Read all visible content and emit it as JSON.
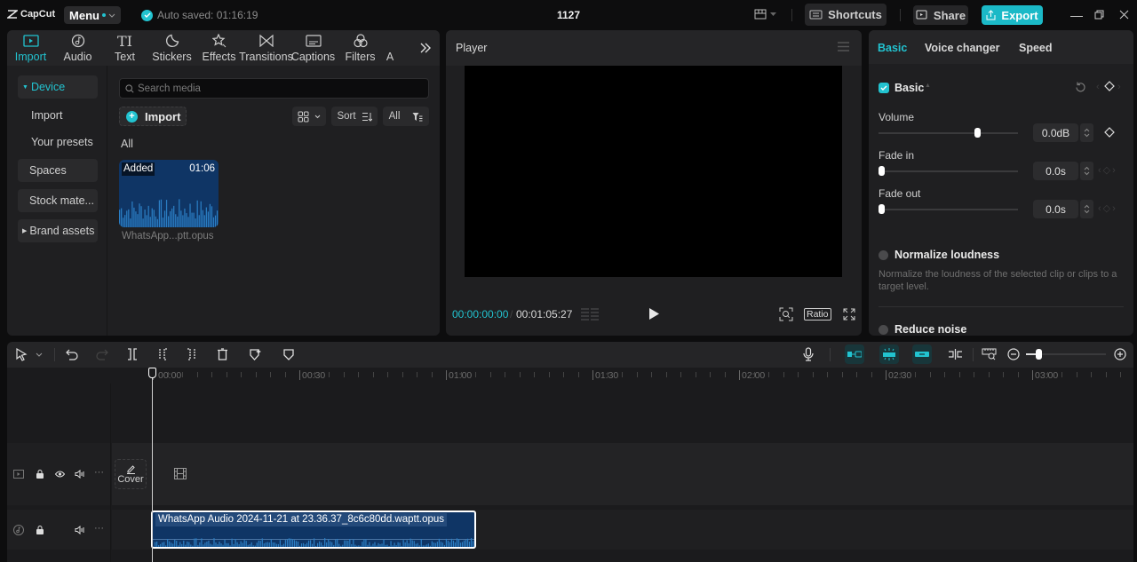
{
  "app": {
    "logo_text": "CapCut",
    "menu_label": "Menu",
    "autosave_text": "Auto saved: 01:16:19",
    "project_title": "1127",
    "shortcuts_label": "Shortcuts",
    "share_label": "Share",
    "export_label": "Export",
    "accent_color": "#22c3d0"
  },
  "media_tabs": [
    {
      "label": "Import",
      "icon": "import-icon",
      "active": true
    },
    {
      "label": "Audio",
      "icon": "audio-icon"
    },
    {
      "label": "Text",
      "icon": "text-icon"
    },
    {
      "label": "Stickers",
      "icon": "stickers-icon"
    },
    {
      "label": "Effects",
      "icon": "effects-icon"
    },
    {
      "label": "Transitions",
      "icon": "transitions-icon"
    },
    {
      "label": "Captions",
      "icon": "captions-icon"
    },
    {
      "label": "Filters",
      "icon": "filters-icon"
    },
    {
      "label": "A",
      "icon": "adjustment-icon"
    }
  ],
  "sidebar": {
    "items": [
      {
        "label": "Device",
        "active": true,
        "expandable": true
      },
      {
        "label": "Import"
      },
      {
        "label": "Your presets"
      },
      {
        "label": "Spaces"
      },
      {
        "label": "Stock mate..."
      },
      {
        "label": "Brand assets",
        "expandable": true
      }
    ]
  },
  "media": {
    "search_placeholder": "Search media",
    "import_label": "Import",
    "sort_label": "Sort",
    "filter_label": "All",
    "section_label": "All",
    "items": [
      {
        "badge": "Added",
        "duration": "01:06",
        "name": "WhatsApp...ptt.opus"
      }
    ]
  },
  "player": {
    "title": "Player",
    "current_time": "00:00:00:00",
    "total_time": "00:01:05:27",
    "ratio_label": "Ratio"
  },
  "properties": {
    "tabs": [
      {
        "label": "Basic",
        "active": true
      },
      {
        "label": "Voice changer"
      },
      {
        "label": "Speed"
      }
    ],
    "section_title": "Basic",
    "section_enabled": true,
    "volume": {
      "label": "Volume",
      "value": "0.0dB",
      "slider_fraction": 0.72
    },
    "fade_in": {
      "label": "Fade in",
      "value": "0.0s",
      "slider_fraction": 0
    },
    "fade_out": {
      "label": "Fade out",
      "value": "0.0s",
      "slider_fraction": 0
    },
    "normalize": {
      "label": "Normalize loudness",
      "checked": false,
      "description": "Normalize the loudness of the selected clip or clips to a target level."
    },
    "reduce_noise": {
      "label": "Reduce noise",
      "checked": false
    }
  },
  "timeline": {
    "ruler_labels": [
      "00:00",
      "00:30",
      "01:00",
      "01:30",
      "02:00",
      "02:30",
      "03:00"
    ],
    "cover_label": "Cover",
    "audio_clip": {
      "name": "WhatsApp Audio 2024-11-21 at 23.36.37_8c6c80dd.waptt.opus"
    },
    "zoom_fraction": 0.12
  }
}
